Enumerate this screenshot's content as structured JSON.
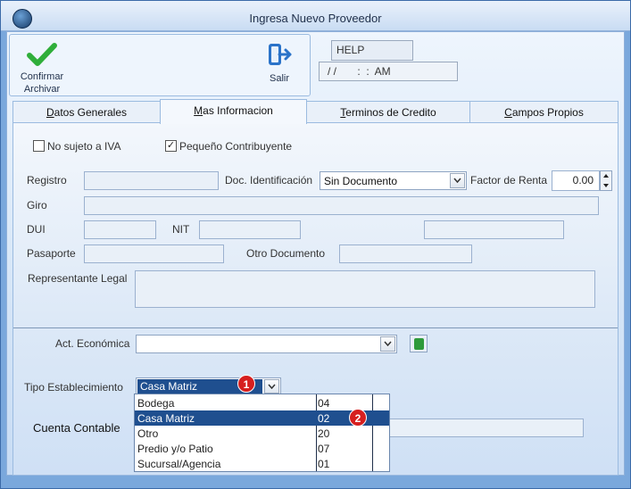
{
  "window": {
    "title": "Ingresa Nuevo Proveedor"
  },
  "toolbar": {
    "confirm_label_1": "Confirmar",
    "confirm_label_2": "Archivar",
    "exit_label": "Salir",
    "help_text": "HELP",
    "datetime_text": "/ /       :  :  AM"
  },
  "tabs": [
    {
      "label": "Datos Generales",
      "underline": "D",
      "rest": "atos Generales"
    },
    {
      "label": "Mas Informacion",
      "underline": "M",
      "rest": "as Informacion"
    },
    {
      "label": "Terminos de Credito",
      "underline": "T",
      "rest": "erminos de Credito"
    },
    {
      "label": "Campos Propios",
      "underline": "C",
      "rest": "ampos Propios"
    }
  ],
  "form": {
    "no_sujeto_iva": {
      "label": "No sujeto a IVA",
      "checked": false
    },
    "pequeno_contribuyente": {
      "label": "Pequeño Contribuyente",
      "checked": true
    },
    "registro": {
      "label": "Registro",
      "value": ""
    },
    "doc_identificacion": {
      "label": "Doc. Identificación",
      "value": "Sin Documento"
    },
    "factor_renta": {
      "label": "Factor de Renta",
      "value": "0.00"
    },
    "giro": {
      "label": "Giro",
      "value": ""
    },
    "dui": {
      "label": "DUI",
      "value": ""
    },
    "nit": {
      "label": "NIT",
      "value": ""
    },
    "pasaporte": {
      "label": "Pasaporte",
      "value": ""
    },
    "otro_documento": {
      "label": "Otro Documento",
      "value": ""
    },
    "representante_legal": {
      "label": "Representante Legal",
      "value": ""
    },
    "act_economica": {
      "label": "Act. Económica",
      "value": ""
    },
    "tipo_establecimiento": {
      "label": "Tipo Establecimiento",
      "value": "Casa Matriz"
    },
    "cuenta_contable": {
      "label": "Cuenta Contable",
      "value": ""
    }
  },
  "dropdown_options": [
    {
      "name": "Bodega",
      "code": "04",
      "selected": false
    },
    {
      "name": "Casa Matriz",
      "code": "02",
      "selected": true
    },
    {
      "name": "Otro",
      "code": "20",
      "selected": false
    },
    {
      "name": "Predio y/o Patio",
      "code": "07",
      "selected": false
    },
    {
      "name": "Sucursal/Agencia",
      "code": "01",
      "selected": false
    }
  ],
  "badges": {
    "one": "1",
    "two": "2"
  },
  "colors": {
    "selection": "#1f4f8f",
    "confirm_icon": "#2fae3a",
    "exit_icon": "#2a73c9",
    "badge": "#d61f1f"
  }
}
